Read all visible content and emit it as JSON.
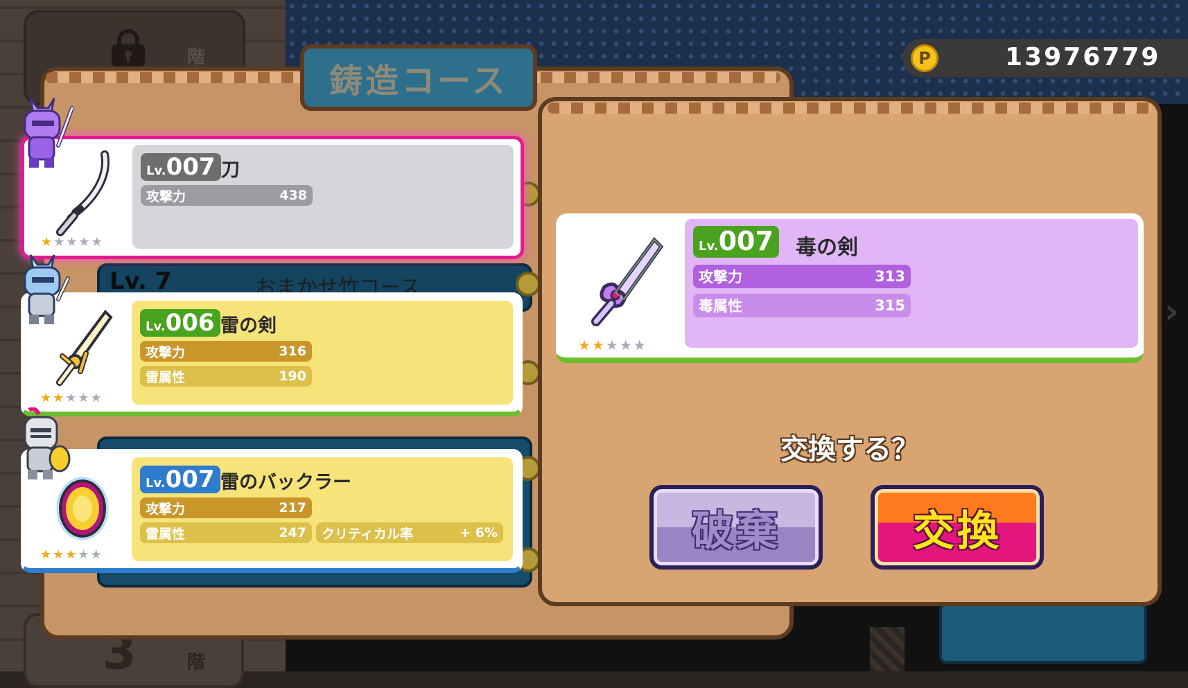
{
  "scene": {
    "floor_char_top": "階",
    "floor_number": "3",
    "floor_char_bottom": "階"
  },
  "course": {
    "title": "鋳造コース",
    "strip_level": "Lv. 7",
    "strip_name": "おまかせ竹コース"
  },
  "coins": {
    "icon": "P",
    "value": "13976779"
  },
  "items": [
    {
      "lv_prefix": "Lv.",
      "level": "007",
      "name": "刀",
      "stats": [
        {
          "label": "攻撃力",
          "value": "438"
        }
      ],
      "stars_filled": 1,
      "stars_total": 5,
      "icon": "katana-icon"
    },
    {
      "lv_prefix": "Lv.",
      "level": "006",
      "name": "雷の剣",
      "stats": [
        {
          "label": "攻撃力",
          "value": "316"
        },
        {
          "label": "雷属性",
          "value": "190"
        }
      ],
      "stars_filled": 2,
      "stars_total": 5,
      "icon": "thunder-sword-icon"
    },
    {
      "lv_prefix": "Lv.",
      "level": "007",
      "name": "雷のバックラー",
      "stats": [
        {
          "label": "攻撃力",
          "value": "217"
        },
        {
          "label": "雷属性",
          "value": "247"
        }
      ],
      "extra_stat": {
        "label": "クリティカル率",
        "value": "+ 6%"
      },
      "stars_filled": 3,
      "stars_total": 5,
      "icon": "buckler-icon"
    }
  ],
  "dialog": {
    "new_item": {
      "lv_prefix": "Lv.",
      "level": "007",
      "name": "毒の剣",
      "stats": [
        {
          "label": "攻撃力",
          "value": "313"
        },
        {
          "label": "毒属性",
          "value": "315"
        }
      ],
      "stars_filled": 2,
      "stars_total": 5,
      "icon": "poison-sword-icon"
    },
    "question": "交換する？",
    "discard_label": "破棄",
    "exchange_label": "交換"
  },
  "colors": {
    "selected_border": "#e11c8e",
    "stat_bar_gold": "#c9962a",
    "stat_bar_purple": "#b160df",
    "lv_green": "#4aa31e",
    "lv_blue": "#2f7ccf",
    "lv_gray": "#6e6e6e"
  }
}
